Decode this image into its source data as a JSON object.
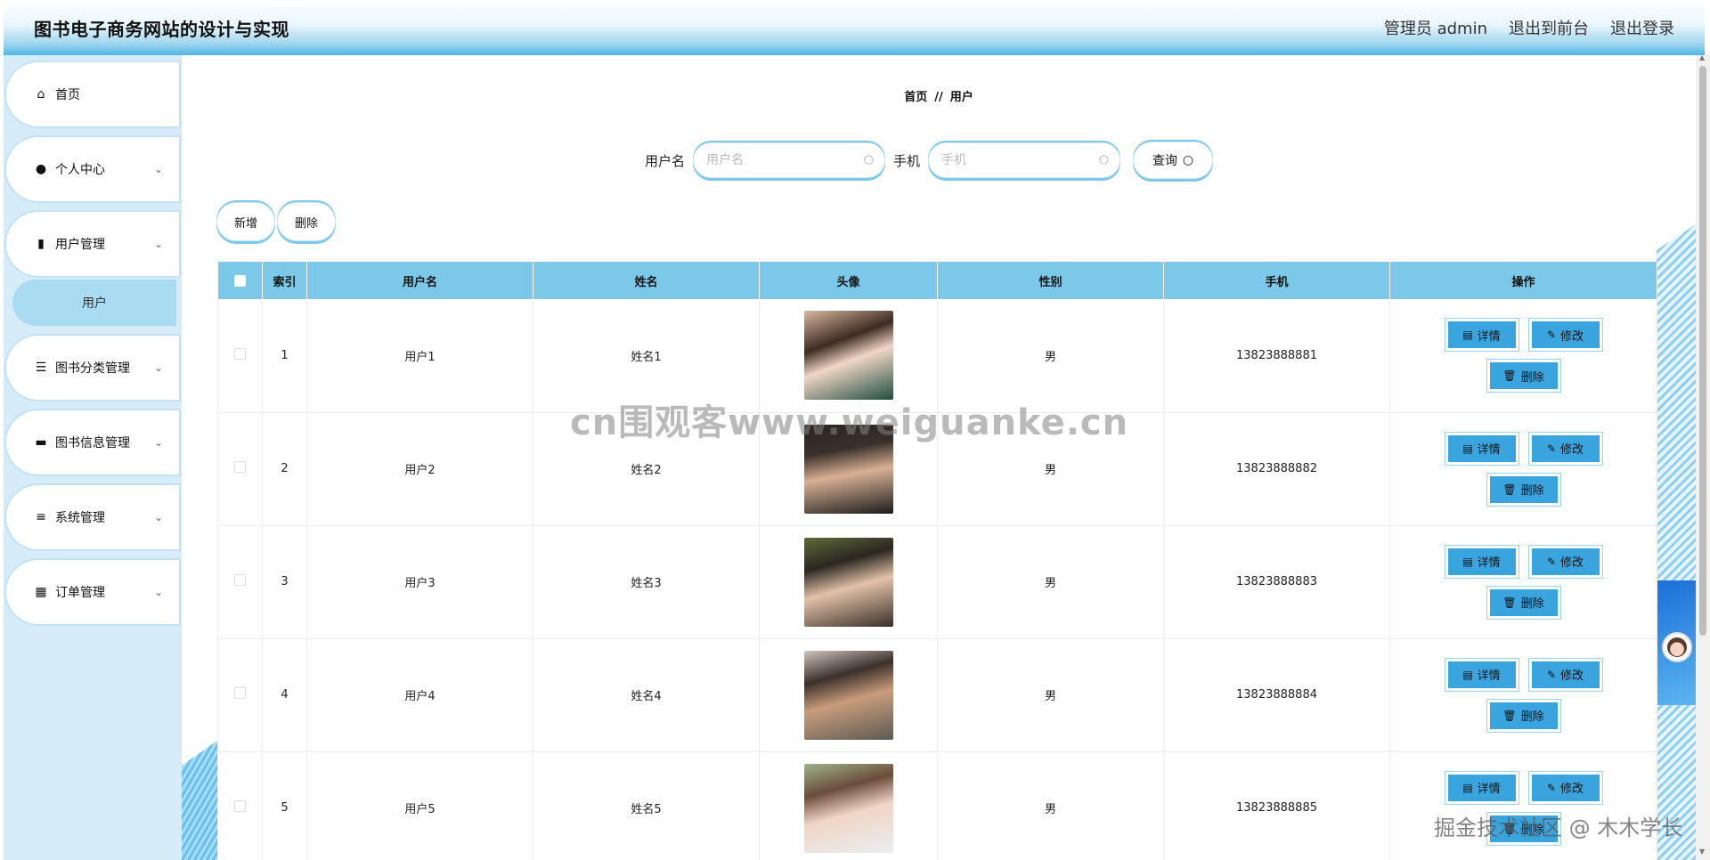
{
  "header": {
    "title": "图书电子商务网站的设计与实现",
    "admin_label": "管理员 admin",
    "front_label": "退出到前台",
    "logout_label": "退出登录"
  },
  "sidebar": {
    "items": [
      {
        "label": "首页",
        "icon": "home-icon",
        "glyph": "⌂"
      },
      {
        "label": "个人中心",
        "icon": "user-icon",
        "glyph": "👤"
      },
      {
        "label": "用户管理",
        "icon": "bar-chart-icon",
        "glyph": "▮"
      },
      {
        "label": "图书分类管理",
        "icon": "list-icon",
        "glyph": "☰"
      },
      {
        "label": "图书信息管理",
        "icon": "ticket-icon",
        "glyph": "▬"
      },
      {
        "label": "系统管理",
        "icon": "sliders-icon",
        "glyph": "≡"
      },
      {
        "label": "订单管理",
        "icon": "grid-icon",
        "glyph": "▦"
      }
    ],
    "sub_item": "用户"
  },
  "breadcrumb": {
    "home": "首页",
    "separator": "//",
    "current": "用户"
  },
  "search": {
    "username_label": "用户名",
    "username_placeholder": "用户名",
    "phone_label": "手机",
    "phone_placeholder": "手机",
    "button_label": "查询"
  },
  "actions": {
    "add_label": "新增",
    "delete_label": "删除"
  },
  "table": {
    "headers": [
      "",
      "索引",
      "用户名",
      "姓名",
      "头像",
      "性别",
      "手机",
      "操作"
    ],
    "rows": [
      {
        "index": "1",
        "username": "用户1",
        "name": "姓名1",
        "gender": "男",
        "phone": "13823888881"
      },
      {
        "index": "2",
        "username": "用户2",
        "name": "姓名2",
        "gender": "男",
        "phone": "13823888882"
      },
      {
        "index": "3",
        "username": "用户3",
        "name": "姓名3",
        "gender": "男",
        "phone": "13823888883"
      },
      {
        "index": "4",
        "username": "用户4",
        "name": "姓名4",
        "gender": "男",
        "phone": "13823888884"
      },
      {
        "index": "5",
        "username": "用户5",
        "name": "姓名5",
        "gender": "男",
        "phone": "13823888885"
      }
    ],
    "op_labels": {
      "detail": "详情",
      "edit": "修改",
      "delete": "删除"
    }
  },
  "watermarks": {
    "center": "cn围观客www.weiguanke.cn",
    "bottom_right": "掘金技术社区 @ 木木学长"
  },
  "colors": {
    "accent": "#7bc8e8",
    "op_button": "#3aa4df",
    "sidebar_bg": "#d6ecf8",
    "header_bottom": "#4eb6e4"
  }
}
